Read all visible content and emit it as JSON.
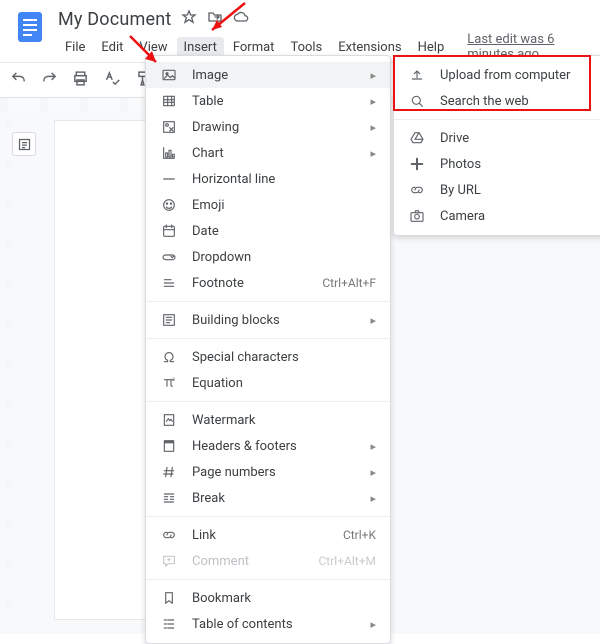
{
  "header": {
    "title": "My Document",
    "menus": [
      "File",
      "Edit",
      "View",
      "Insert",
      "Format",
      "Tools",
      "Extensions",
      "Help"
    ],
    "active_menu_index": 3,
    "last_edit": "Last edit was 6 minutes ago"
  },
  "insert_menu": {
    "groups": [
      [
        {
          "id": "image",
          "label": "Image",
          "icon": "image",
          "submenu": true,
          "hover": true
        },
        {
          "id": "table",
          "label": "Table",
          "icon": "table",
          "submenu": true
        },
        {
          "id": "drawing",
          "label": "Drawing",
          "icon": "drawing",
          "submenu": true
        },
        {
          "id": "chart",
          "label": "Chart",
          "icon": "chart",
          "submenu": true
        },
        {
          "id": "hr",
          "label": "Horizontal line",
          "icon": "hr"
        },
        {
          "id": "emoji",
          "label": "Emoji",
          "icon": "emoji"
        },
        {
          "id": "date",
          "label": "Date",
          "icon": "date"
        },
        {
          "id": "dropdown",
          "label": "Dropdown",
          "icon": "dropdown"
        },
        {
          "id": "footnote",
          "label": "Footnote",
          "icon": "footnote",
          "shortcut": "Ctrl+Alt+F"
        }
      ],
      [
        {
          "id": "building-blocks",
          "label": "Building blocks",
          "icon": "blocks",
          "submenu": true
        }
      ],
      [
        {
          "id": "special-chars",
          "label": "Special characters",
          "icon": "omega"
        },
        {
          "id": "equation",
          "label": "Equation",
          "icon": "pi"
        }
      ],
      [
        {
          "id": "watermark",
          "label": "Watermark",
          "icon": "watermark"
        },
        {
          "id": "headers-footers",
          "label": "Headers & footers",
          "icon": "headers",
          "submenu": true
        },
        {
          "id": "page-numbers",
          "label": "Page numbers",
          "icon": "hash",
          "submenu": true
        },
        {
          "id": "break",
          "label": "Break",
          "icon": "break",
          "submenu": true
        }
      ],
      [
        {
          "id": "link",
          "label": "Link",
          "icon": "link",
          "shortcut": "Ctrl+K"
        },
        {
          "id": "comment",
          "label": "Comment",
          "icon": "comment",
          "shortcut": "Ctrl+Alt+M",
          "disabled": true
        }
      ],
      [
        {
          "id": "bookmark",
          "label": "Bookmark",
          "icon": "bookmark"
        },
        {
          "id": "toc",
          "label": "Table of contents",
          "icon": "toc",
          "submenu": true
        }
      ]
    ]
  },
  "image_submenu": {
    "groups": [
      [
        {
          "id": "upload",
          "label": "Upload from computer",
          "icon": "upload"
        },
        {
          "id": "search-web",
          "label": "Search the web",
          "icon": "search"
        }
      ],
      [
        {
          "id": "drive",
          "label": "Drive",
          "icon": "drive"
        },
        {
          "id": "photos",
          "label": "Photos",
          "icon": "photos"
        },
        {
          "id": "by-url",
          "label": "By URL",
          "icon": "link"
        },
        {
          "id": "camera",
          "label": "Camera",
          "icon": "camera"
        }
      ]
    ]
  }
}
